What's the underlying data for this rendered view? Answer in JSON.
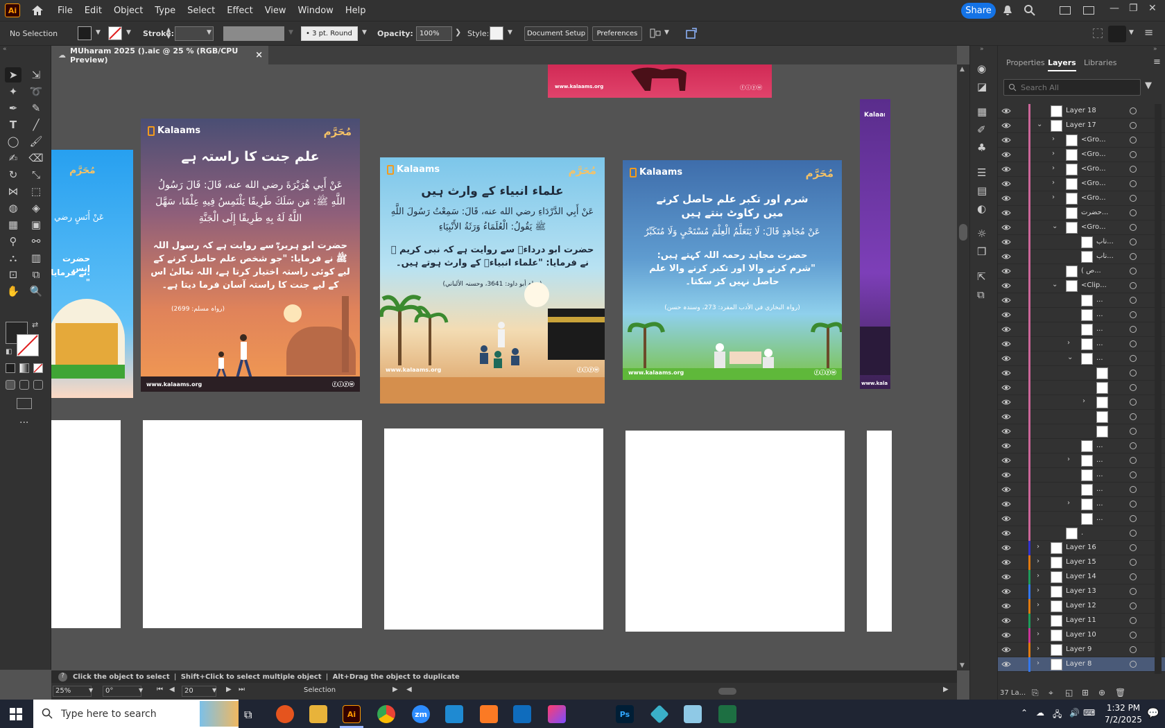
{
  "app": {
    "logo": "Ai",
    "menus": [
      "File",
      "Edit",
      "Object",
      "Type",
      "Select",
      "Effect",
      "View",
      "Window",
      "Help"
    ],
    "share_label": "Share"
  },
  "control_bar": {
    "selection_label": "No Selection",
    "stroke_label": "Stroke:",
    "brush_label": "3 pt. Round",
    "opacity_label": "Opacity:",
    "opacity_value": "100%",
    "style_label": "Style:",
    "document_setup": "Document Setup",
    "preferences": "Preferences"
  },
  "document_tab": {
    "title": "MUharam 2025 ().aic @ 25 % (RGB/CPU Preview)",
    "close": "×"
  },
  "artboards": {
    "card1": {
      "brand": "Kalaams",
      "muharram": "مُحَرَّم",
      "title": "علم جنت کا راستہ ہے",
      "arabic": "عَنْ أَبِي هُرَيْرَةَ رضي الله عنه، قَالَ: قَالَ رَسُولُ اللَّهِ ﷺ: مَن سَلَكَ طَرِيقًا يَلْتَمِسُ فِيهِ عِلْمًا، سَهَّلَ اللَّهُ لَهُ بِهِ طَرِيقًا إِلَى الْجَنَّةِ",
      "urdu": "حضرت ابو ہریرہؓ سے روایت ہے کہ رسول اللہ ﷺ نے فرمایا: \"جو شخص علم حاصل کرنے کے لیے کوئی راستہ اختیار کرتا ہے، اللہ تعالیٰ اس کے لیے جنت کا راستہ آسان فرما دیتا ہے۔",
      "ref": "(رواہ مسلم: 2699)",
      "site": "www.kalaams.org"
    },
    "card2": {
      "brand": "Kalaams",
      "muharram": "مُحَرَّم",
      "title": "علماء انبیاء کے وارث ہیں",
      "arabic": "عَنْ أَبِي الدَّرْدَاءِ رضي الله عنه، قَالَ: سَمِعْتُ رَسُولَ اللَّهِ ﷺ يَقُولُ: الْعُلَمَاءُ وَرَثَةُ الأَنْبِيَاءِ",
      "urdu": "حضرت ابو درداءؓ سے روایت ہے کہ نبی کریم ﷺ نے فرمایا: \"علماء انبیاءؑ کے وارث ہوتے ہیں۔",
      "ref": "(رواہ أبو داود: 3641، وحسنہ الألباني)",
      "site": "www.kalaams.org"
    },
    "card3": {
      "brand": "Kalaams",
      "muharram": "مُحَرَّم",
      "title": "شرم اور تکبر علم حاصل کرنے میں رکاوٹ بنتے ہیں",
      "arabic": "عَنْ مُجَاهِدٍ قَالَ: لَا يَتَعَلَّمُ الْعِلْمَ مُسْتَحْيٍ وَلَا مُتَكَبِّرٌ",
      "urdu": "حضرت مجاہد رحمہ اللہ کہتے ہیں: \"شرم کرنے والا اور تکبر کرنے والا علم حاصل نہیں کر سکتا۔",
      "ref": "(رواہ البخاري في الأدب المفرد: 273، وسندہ حسن)",
      "site": "www.kalaams.org"
    },
    "left_card": {
      "muharram": "مُحَرَّم",
      "arabic": "عَنْ أَنَسٍ رضي",
      "urdu1": "حضرت انس",
      "urdu2": "نے فرمایا: \""
    },
    "top_banner": {
      "site": "www.kalaams.org"
    },
    "right_card": {
      "brand": "Kalaams",
      "site": "www.kala"
    }
  },
  "status_hint": {
    "t1": "Click the object to select",
    "t2": "Shift+Click to select multiple object",
    "t3": "Alt+Drag the object to duplicate"
  },
  "status_bar": {
    "zoom": "25%",
    "rotation": "0°",
    "artboard": "20",
    "tool": "Selection"
  },
  "panel": {
    "tabs": [
      "Properties",
      "Layers",
      "Libraries"
    ],
    "search_placeholder": "Search All",
    "layers": [
      {
        "name": "Layer 18",
        "indent": 0,
        "arrow": "",
        "color": "#cc6699"
      },
      {
        "name": "Layer 17",
        "indent": 0,
        "arrow": "v",
        "color": "#cc6699"
      },
      {
        "name": "<Gro...",
        "indent": 1,
        "arrow": ">",
        "color": "#cc6699"
      },
      {
        "name": "<Gro...",
        "indent": 1,
        "arrow": ">",
        "color": "#cc6699"
      },
      {
        "name": "<Gro...",
        "indent": 1,
        "arrow": ">",
        "color": "#cc6699"
      },
      {
        "name": "<Gro...",
        "indent": 1,
        "arrow": ">",
        "color": "#cc6699"
      },
      {
        "name": "<Gro...",
        "indent": 1,
        "arrow": ">",
        "color": "#cc6699"
      },
      {
        "name": "حضرت...",
        "indent": 1,
        "arrow": "",
        "color": "#cc6699"
      },
      {
        "name": "<Gro...",
        "indent": 1,
        "arrow": "v",
        "color": "#cc6699"
      },
      {
        "name": "ناب...",
        "indent": 2,
        "arrow": "",
        "color": "#cc6699"
      },
      {
        "name": "ناب...",
        "indent": 2,
        "arrow": "",
        "color": "#cc6699"
      },
      {
        "name": "( ص...",
        "indent": 1,
        "arrow": "",
        "color": "#cc6699"
      },
      {
        "name": "<Clip...",
        "indent": 1,
        "arrow": "v",
        "color": "#cc6699"
      },
      {
        "name": "...",
        "indent": 2,
        "arrow": "",
        "color": "#cc6699"
      },
      {
        "name": "...",
        "indent": 2,
        "arrow": "",
        "color": "#cc6699"
      },
      {
        "name": "...",
        "indent": 2,
        "arrow": "",
        "color": "#cc6699"
      },
      {
        "name": "...",
        "indent": 2,
        "arrow": ">",
        "color": "#cc6699"
      },
      {
        "name": "...",
        "indent": 2,
        "arrow": "v",
        "color": "#cc6699"
      },
      {
        "name": "",
        "indent": 3,
        "arrow": "",
        "color": "#cc6699"
      },
      {
        "name": "",
        "indent": 3,
        "arrow": "",
        "color": "#cc6699"
      },
      {
        "name": "",
        "indent": 3,
        "arrow": ">",
        "color": "#cc6699"
      },
      {
        "name": "",
        "indent": 3,
        "arrow": "",
        "color": "#cc6699"
      },
      {
        "name": "",
        "indent": 3,
        "arrow": "",
        "color": "#cc6699"
      },
      {
        "name": "...",
        "indent": 2,
        "arrow": "",
        "color": "#cc6699"
      },
      {
        "name": "...",
        "indent": 2,
        "arrow": ">",
        "color": "#cc6699"
      },
      {
        "name": "...",
        "indent": 2,
        "arrow": "",
        "color": "#cc6699"
      },
      {
        "name": "...",
        "indent": 2,
        "arrow": "",
        "color": "#cc6699"
      },
      {
        "name": "...",
        "indent": 2,
        "arrow": ">",
        "color": "#cc6699"
      },
      {
        "name": "...",
        "indent": 2,
        "arrow": "",
        "color": "#cc6699"
      },
      {
        "name": ".",
        "indent": 1,
        "arrow": "",
        "color": "#cc6699"
      },
      {
        "name": "Layer 16",
        "indent": 0,
        "arrow": ">",
        "color": "#3333cc"
      },
      {
        "name": "Layer 15",
        "indent": 0,
        "arrow": ">",
        "color": "#e07a10"
      },
      {
        "name": "Layer 14",
        "indent": 0,
        "arrow": ">",
        "color": "#1e9a5a"
      },
      {
        "name": "Layer 13",
        "indent": 0,
        "arrow": ">",
        "color": "#3377ee"
      },
      {
        "name": "Layer 12",
        "indent": 0,
        "arrow": ">",
        "color": "#e07a10"
      },
      {
        "name": "Layer 11",
        "indent": 0,
        "arrow": ">",
        "color": "#1e9a5a"
      },
      {
        "name": "Layer 10",
        "indent": 0,
        "arrow": ">",
        "color": "#cc3399"
      },
      {
        "name": "Layer 9",
        "indent": 0,
        "arrow": ">",
        "color": "#e07a10"
      },
      {
        "name": "Layer 8",
        "indent": 0,
        "arrow": ">",
        "color": "#3377ee",
        "selected": true
      }
    ],
    "layer_count": "37 La..."
  },
  "taskbar": {
    "search_placeholder": "Type here to search",
    "time": "1:32 PM",
    "date": "7/2/2025",
    "icons": [
      "Ai",
      "Ps",
      "zm"
    ]
  }
}
